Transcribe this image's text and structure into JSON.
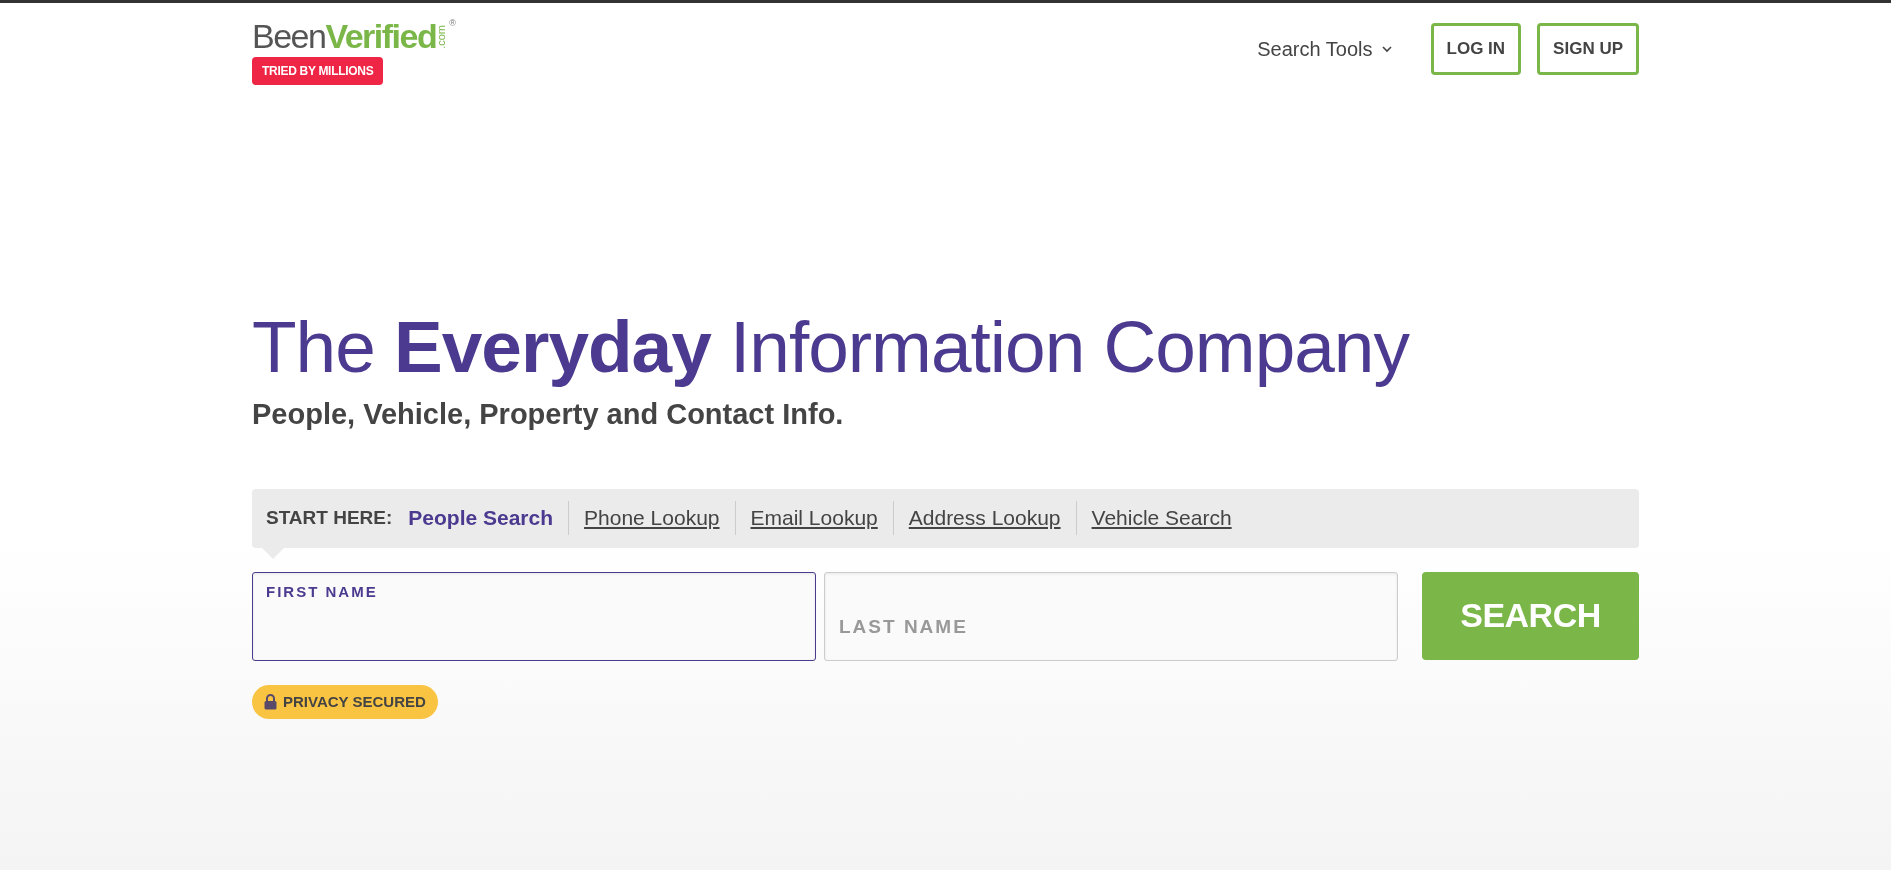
{
  "header": {
    "logo": {
      "first": "Been",
      "second": "Verified",
      "domain": ".com",
      "registered": "®"
    },
    "logo_badge": "TRIED BY MILLIONS",
    "nav": {
      "menu": "Search Tools",
      "expanded": false
    },
    "buttons": [
      "LOG IN",
      "SIGN UP"
    ]
  },
  "hero": {
    "title": "The **Everyday** Information Company",
    "subtitle": "People, Vehicle, Property and Contact Info."
  },
  "search": {
    "prompt": "START HERE:",
    "tabs": [
      {
        "label": "People Search",
        "selected": true
      },
      {
        "label": "Phone Lookup",
        "selected": false
      },
      {
        "label": "Email Lookup",
        "selected": false
      },
      {
        "label": "Address Lookup",
        "selected": false
      },
      {
        "label": "Vehicle Search",
        "selected": false
      }
    ],
    "fields": [
      {
        "label": "FIRST NAME",
        "focused": true
      },
      {
        "placeholder": "LAST NAME",
        "focused": false
      }
    ],
    "button": "SEARCH",
    "privacy": "PRIVACY SECURED"
  }
}
